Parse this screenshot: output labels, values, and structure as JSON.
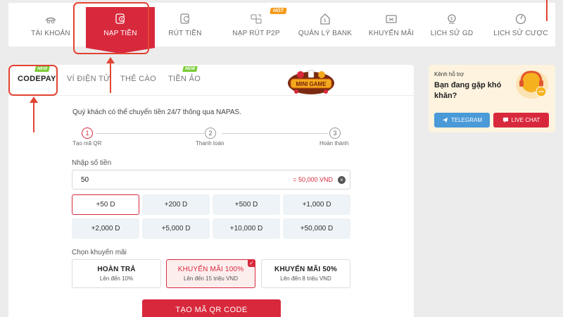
{
  "nav": {
    "items": [
      {
        "label": "TÀI KHOẢN",
        "icon": "account-icon"
      },
      {
        "label": "NẠP TIỀN",
        "icon": "deposit-icon"
      },
      {
        "label": "RÚT TIỀN",
        "icon": "withdraw-icon"
      },
      {
        "label": "NẠP RÚT P2P",
        "icon": "p2p-icon"
      },
      {
        "label": "QUẢN LÝ BANK",
        "icon": "bank-icon"
      },
      {
        "label": "KHUYẾN MÃI",
        "icon": "promotion-icon"
      },
      {
        "label": "LỊCH SỬ GD",
        "icon": "history-icon"
      },
      {
        "label": "LỊCH SỬ CƯỢC",
        "icon": "bet-history-icon"
      }
    ],
    "hot_badge": "HOT",
    "active_color": "#d8293c"
  },
  "tabs": [
    {
      "label": "CODEPAY",
      "badge": "NEW"
    },
    {
      "label": "VÍ ĐIỆN TỬ"
    },
    {
      "label": "THẺ CÀO"
    },
    {
      "label": "TIỀN ẢO",
      "badge": "NEW"
    }
  ],
  "logo_text": "MINI GAME",
  "intro": "Quý khách có thể chuyển tiền 24/7 thông qua NAPAS.",
  "steps": [
    {
      "num": "1",
      "label": "Tạo mã QR"
    },
    {
      "num": "2",
      "label": "Thanh toán"
    },
    {
      "num": "3",
      "label": "Hoàn thành"
    }
  ],
  "amount": {
    "label": "Nhập số tiền",
    "value": "50",
    "converted": "= 50,000 VND",
    "clear": "×"
  },
  "chips": [
    "+50 D",
    "+200 D",
    "+500 D",
    "+1,000 D",
    "+2,000 D",
    "+5,000 D",
    "+10,000 D",
    "+50,000 D"
  ],
  "promo": {
    "label": "Chọn khuyến mãi",
    "options": [
      {
        "title": "HOÀN TRẢ",
        "sub": "Lên đến 10%"
      },
      {
        "title": "KHUYẾN MÃI 100%",
        "sub": "Lên đến 15 triệu VND"
      },
      {
        "title": "KHUYẾN MÃI 50%",
        "sub": "Lên đến 8 triệu VND"
      }
    ],
    "check": "✓"
  },
  "submit_label": "TẠO MÃ QR CODE",
  "support": {
    "title": "Kênh hỗ trợ",
    "subtitle": "Bạn đang gặp khó khăn?",
    "telegram": "TELEGRAM",
    "livechat": "LIVE CHAT"
  }
}
